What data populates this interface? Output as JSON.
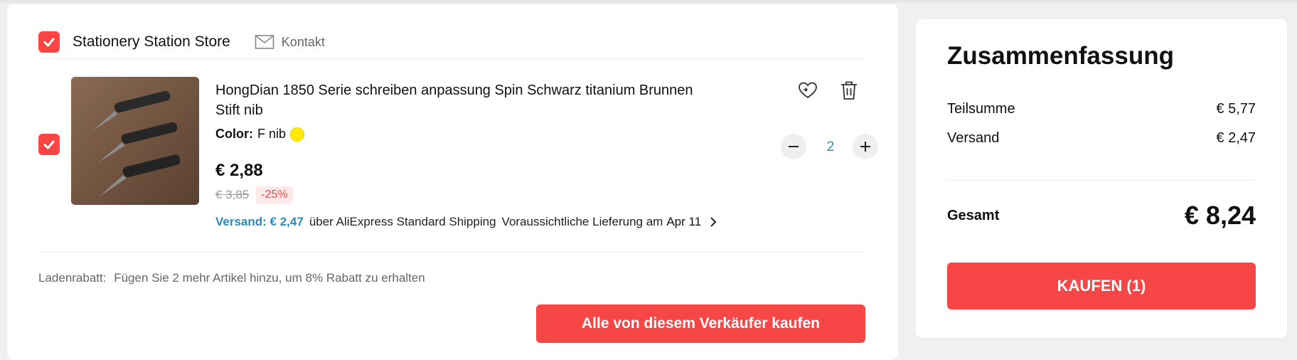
{
  "store": {
    "name": "Stationery Station Store",
    "contact_label": "Kontakt",
    "checked": true
  },
  "item": {
    "checked": true,
    "title": "HongDian 1850 Serie schreiben anpassung Spin Schwarz titanium Brunnen Stift nib",
    "color_label": "Color:",
    "color_value": "F nib",
    "color_swatch": "#ffea00",
    "price": "€ 2,88",
    "old_price": "€ 3,85",
    "discount": "-25%",
    "shipping_fee": "Versand: € 2,47",
    "shipping_method": "über AliExpress Standard Shipping",
    "delivery_label": "Voraussichtliche Lieferung am",
    "delivery_date": "Apr 11",
    "quantity": "2",
    "icons": [
      "wishlist-icon",
      "trash-icon",
      "minus-icon",
      "plus-icon",
      "chevron-right-icon"
    ]
  },
  "promo": {
    "label": "Ladenrabatt:",
    "text": "Fügen Sie 2 mehr Artikel hinzu, um 8% Rabatt zu erhalten"
  },
  "seller_button_label": "Alle von diesem Verkäufer kaufen",
  "summary": {
    "title": "Zusammenfassung",
    "subtotal_label": "Teilsumme",
    "subtotal_value": "€ 5,77",
    "shipping_label": "Versand",
    "shipping_value": "€ 2,47",
    "total_label": "Gesamt",
    "total_value": "€ 8,24",
    "buy_label": "KAUFEN (1)"
  },
  "colors": {
    "accent": "#f64646",
    "link": "#2c8bb7",
    "checkbox": "#ff4444"
  }
}
